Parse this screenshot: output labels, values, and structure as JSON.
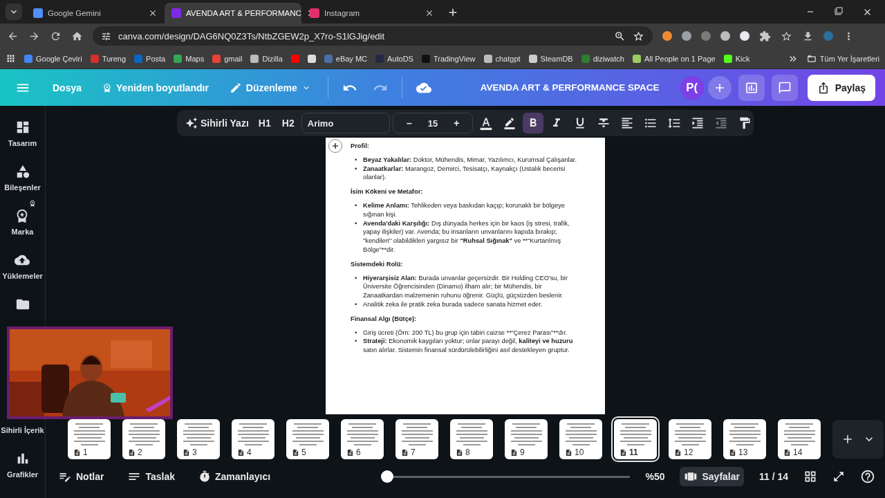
{
  "browser": {
    "tabs": [
      {
        "title": "Google Gemini",
        "selected": false,
        "color": "#4f8ff7"
      },
      {
        "title": "AVENDA ART & PERFORMANC",
        "selected": true,
        "color": "#7d2ae8"
      },
      {
        "title": "Instagram",
        "selected": false,
        "color": "#e1306c"
      }
    ],
    "url": "canva.com/design/DAG6NQ0Z3Ts/NtbZGEW2p_X7ro-S1lGJig/edit",
    "bookmarks": [
      {
        "label": "Google Çeviri",
        "color": "#4285f4"
      },
      {
        "label": "Tureng",
        "color": "#d32f2f"
      },
      {
        "label": "Posta",
        "color": "#0a66c2"
      },
      {
        "label": "Maps",
        "color": "#34a853"
      },
      {
        "label": "gmail",
        "color": "#ea4335"
      },
      {
        "label": "Dizilla",
        "color": "#bbbbbb"
      },
      {
        "color": "#ff0000"
      },
      {
        "color": "#dddddd"
      },
      {
        "label": "eBay MC",
        "color": "#4a6fa5"
      },
      {
        "label": "AutoDS",
        "color": "#222a44"
      },
      {
        "label": "TradingView",
        "color": "#111111"
      },
      {
        "label": "chatgpt",
        "color": "#bbbbbb"
      },
      {
        "label": "SteamDB",
        "color": "#cccccc"
      },
      {
        "label": "diziwatch",
        "color": "#2e7d32"
      },
      {
        "label": "All People on 1 Page",
        "color": "#9ccc65"
      },
      {
        "label": "Kick",
        "color": "#53fc18"
      }
    ],
    "other_bookmarks": "Tüm Yer İşaretleri"
  },
  "header": {
    "menu": [
      "Dosya",
      "Yeniden boyutlandır",
      "Düzenleme"
    ],
    "title": "AVENDA ART & PERFORMANCE SPACE",
    "avatar": "P(",
    "share": "Paylaş"
  },
  "toolbar": {
    "magic_write": "Sihirli Yazı",
    "h1": "H1",
    "h2": "H2",
    "font": "Arimo",
    "minus": "–",
    "size": "15",
    "plus": "+",
    "bold_on": true
  },
  "sidebar": [
    {
      "label": "Tasarım",
      "kind": "design"
    },
    {
      "label": "Bileşenler",
      "kind": "elements"
    },
    {
      "label": "Marka",
      "kind": "brand"
    },
    {
      "label": "Yüklemeler",
      "kind": "uploads"
    },
    {
      "kind": "folder"
    },
    {
      "label": "Sihirli İçerik",
      "kind": "magic"
    },
    {
      "label": "Grafikler",
      "kind": "charts"
    }
  ],
  "document": [
    {
      "heading": "Profil:",
      "bullets": [
        {
          "marker": "•",
          "parts": [
            {
              "text": "Beyaz Yakalılar:",
              "bold": true
            },
            {
              "text": " Doktor, Mühendis, Mimar, Yazılımcı, Kurumsal Çalışanlar.",
              "bold": false
            }
          ]
        },
        {
          "marker": "•",
          "parts": [
            {
              "text": "Zanaatkarlar:",
              "bold": true
            },
            {
              "text": " Marangoz, Demirci, Tesisatçı, Kaynakçı (Ustalık becerisi olanlar).",
              "bold": false
            }
          ]
        }
      ]
    },
    {
      "heading": "İsim Kökeni ve Metafor:",
      "bullets": [
        {
          "marker": "•",
          "parts": [
            {
              "text": "Kelime Anlamı:",
              "bold": true
            },
            {
              "text": " Tehlikeden veya baskıdan kaçıp; korunaklı bir bölgeye sığınan kişi.",
              "bold": false
            }
          ]
        },
        {
          "marker": "•",
          "parts": [
            {
              "text": "Avenda'daki Karşılığı:",
              "bold": true
            },
            {
              "text": " Dış dünyada herkes için bir kaos (iş stresi, trafik, yapay ilişkiler) var. Avenda; bu insanların unvanlarını kapıda bırakıp; \"kendileri\" olabildikleri yargısız bir ",
              "bold": false
            },
            {
              "text": "\"Ruhsal Sığınak\"",
              "bold": true
            },
            {
              "text": " ve **“Kurtarılmış Bölge”**dir.",
              "bold": false
            }
          ]
        }
      ]
    },
    {
      "heading": "Sistemdeki Rolü:",
      "bullets": [
        {
          "marker": "•",
          "parts": [
            {
              "text": "Hiyerarşisiz Alan:",
              "bold": true
            },
            {
              "text": " Burada unvanlar geçersizdir. Bir Holding CEO'su, bir Üniversite Öğrencisinden (Dinamo) ilham alır; bir Mühendis, bir Zanaatkardan malzemenin ruhunu öğrenir. Güçlü, güçsüzden beslenir.",
              "bold": false
            }
          ]
        },
        {
          "marker": "•",
          "parts": [
            {
              "text": "Analitik zeka ile pratik zeka burada sadece sanata hizmet eder.",
              "bold": false
            }
          ]
        }
      ]
    },
    {
      "heading": "Finansal Algı (Bütçe):",
      "bullets": [
        {
          "marker": "•",
          "parts": [
            {
              "text": "Giriş ücreti (Örn: 200 TL) bu grup için tabiri caizse **“Çerez Parası”**dır.",
              "bold": false
            }
          ]
        },
        {
          "marker": "•",
          "parts": [
            {
              "text": "Strateji:",
              "bold": true
            },
            {
              "text": " Ekonomik kaygıları yoktur; onlar parayı değil, ",
              "bold": false
            },
            {
              "text": "kaliteyi ve huzuru",
              "bold": true
            },
            {
              "text": " satın alırlar. Sistemin finansal sürdürülebilirliğini asıl destekleyen gruptur.",
              "bold": false
            }
          ]
        }
      ]
    }
  ],
  "pages": [
    {
      "number": "1",
      "selected": false
    },
    {
      "number": "2",
      "selected": false
    },
    {
      "number": "3",
      "selected": false
    },
    {
      "number": "4",
      "selected": false
    },
    {
      "number": "5",
      "selected": false
    },
    {
      "number": "6",
      "selected": false
    },
    {
      "number": "7",
      "selected": false
    },
    {
      "number": "8",
      "selected": false
    },
    {
      "number": "9",
      "selected": false
    },
    {
      "number": "10",
      "selected": false
    },
    {
      "number": "11",
      "selected": true
    },
    {
      "number": "12",
      "selected": false
    },
    {
      "number": "13",
      "selected": false
    },
    {
      "number": "14",
      "selected": false
    }
  ],
  "footer": {
    "notes": "Notlar",
    "outline": "Taslak",
    "timer": "Zamanlayıcı",
    "zoom": {
      "level": 0
    },
    "zoom_text": "%50",
    "pages_button": "Sayfalar",
    "page_count": "11 / 14"
  }
}
